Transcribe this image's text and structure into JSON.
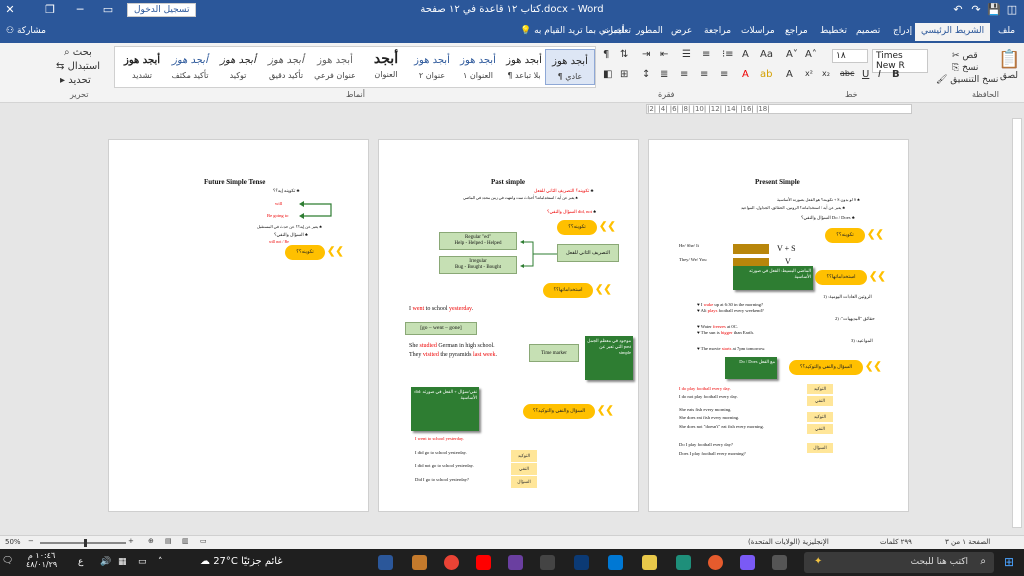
{
  "window": {
    "title": "كتاب ١٢ قاعدة في ١٢ صفحة.docx - Word",
    "signin": "تسجيل الدخول"
  },
  "tabs": [
    "ملف",
    "الشريط الرئيسي",
    "إدراج",
    "تصميم",
    "تخطيط",
    "مراجع",
    "مراسلات",
    "مراجعة",
    "عرض",
    "المطور",
    "تعليمات"
  ],
  "tell_me": "أخبرني بما تريد القيام به",
  "share": "مشاركة",
  "ribbon": {
    "groups": {
      "clipboard": "الحافظة",
      "font": "خط",
      "paragraph": "فقرة",
      "styles": "أنماط",
      "editing": "تحرير"
    },
    "clipboard": {
      "paste": "لصق",
      "cut": "قص",
      "copy": "نسخ",
      "format_painter": "نسخ التنسيق"
    },
    "font": {
      "name": "Times New R",
      "size": "١٨"
    },
    "editing": {
      "find": "بحث",
      "replace": "استبدال",
      "select": "تحديد"
    },
    "styles": [
      {
        "sample": "أبجد هوز",
        "name": "¶ عادي"
      },
      {
        "sample": "أبجد هوز",
        "name": "¶ بلا تباعد"
      },
      {
        "sample": "أبجد هوز",
        "name": "العنوان ١"
      },
      {
        "sample": "أبجد هوز",
        "name": "عنوان ٢"
      },
      {
        "sample": "أبجد",
        "name": "العنوان"
      },
      {
        "sample": "أبجد هوز",
        "name": "عنوان فرعي"
      },
      {
        "sample": "أبجد هوز",
        "name": "تأكيد دقيق"
      },
      {
        "sample": "أبجد هوز",
        "name": "توكيد"
      },
      {
        "sample": "أبجد هوز",
        "name": "تأكيد مكثف"
      },
      {
        "sample": "أبجد هوز",
        "name": "تشديد"
      }
    ]
  },
  "ruler": "|2| |4| |6| |8| |10| |12| |14| |16| |18|",
  "pages": {
    "right": {
      "title": "Present Simple",
      "q1": "تكوينه؟ هو الفعل بصورته الأساسية + S لو بدون S",
      "q2": "يعبر عن أيه / استخداماته؟ الروتين، الحقائق، الجداول، المواعيد",
      "q3": "السؤال والنفي؟ Do / Does",
      "pill1": "تكوينه؟؟",
      "formula1": "He/ She/ It",
      "formula2": "They/ We/ You",
      "vs": "V + S",
      "v": "V",
      "pill2": "استخداماتها؟؟",
      "green1": "الماضي البسيط: الفعل في صورته الأساسية",
      "u1": "الروتين العادات اليومية:",
      "ex1a_pre": "I ",
      "ex1a_red": "wake",
      "ex1a_post": " up at 6:30 in the morning?",
      "ex1b_pre": "Ali ",
      "ex1b_red": "plays",
      "ex1b_post": " football every weekend?",
      "u2": "حقائق \"البديهيات\":",
      "ex2a_pre": "Water ",
      "ex2a_red": "freezes",
      "ex2a_post": " at 0C.",
      "ex2b_pre": "The sun is ",
      "ex2b_red": "bigger",
      "ex2b_post": " than Earth.",
      "u3": "المواعيد:",
      "ex3_pre": "The movie ",
      "ex3_red": "starts",
      "ex3_post": " at 7pm tomorrow.",
      "green2": "Do / Does مع الفعل",
      "pill3": "السؤال والنفي والتوكيد؟؟",
      "s1": "I do play football every day.",
      "s2": "I do not play football every day.",
      "s3": "She eats fish every morning.",
      "s4": "She does eat fish every morning.",
      "s5": "She does not \"doesn't\" eat fish every morning.",
      "s6": "Do I play football every day?",
      "s7": "Does I play football every morning?",
      "lbl1": "التوكيد",
      "lbl2": "النفي",
      "lbl3": "التوكيد",
      "lbl4": "النفي",
      "lbl5": "السؤال"
    },
    "middle": {
      "title": "Past simple",
      "q1": "تكوينه؟ التصريف الثاني للفعل",
      "q2": "يعبر عن أيه / استخداماته؟ أحداث تمت وانتهت في زمن محدد في الماضي",
      "q3": "السؤال والنفي؟ did, not",
      "pill1": "تكوينه؟؟",
      "box1a": "Regular \"ed\"",
      "box1b": "Help - Helped - Helped",
      "box2a": "Irregular",
      "box2b": "Bug - Bought - Bought",
      "green1": "التصريف الثاني للفعل",
      "pill2": "استخداماتها؟؟",
      "ex1_pre": "I ",
      "ex1_red": "went",
      "ex1_mid": " to school ",
      "ex1_red2": "yesterday",
      "ex1_post": ".",
      "forms": "[go – went – gone]",
      "ex2_pre": "She ",
      "ex2_red": "studied",
      "ex2_post": " German in high school.",
      "ex3_pre": "They ",
      "ex3_red": "visited",
      "ex3_mid": " the pyramids ",
      "ex3_red2": "last week",
      "ex3_post": ".",
      "time_marker": "Time marker",
      "green2": "موجود في معظم الجمل التي تعبر عن past simple",
      "green3": "did: نفي/سؤال + الفعل في صورته الأساسية",
      "pill3": "السؤال والنفي والتوكيد؟؟",
      "s1": "I went to school yesterday.",
      "s2": "I did go to school yesterday.",
      "s3": "I did not go to school yesterday.",
      "s4": "Did I go to school yesterday?",
      "lbl1": "التوكيد",
      "lbl2": "النفي",
      "lbl3": "السؤال"
    },
    "left": {
      "title": "Future Simple Tense",
      "q1": "تكوينه إيه؟؟",
      "will": "will",
      "going": "Be going to",
      "q2": "يعبر عن إيه؟؟ عن حدث في المستقبل",
      "q3": "السؤال والنفي؟",
      "q3b": "will not / Be",
      "pill1": "تكوينه؟؟"
    }
  },
  "status": {
    "page": "الصفحة ١ من ٣",
    "words": "٢٩٩ كلمات",
    "lang": "الإنجليزية (الولايات المتحدة)",
    "zoom": "50%"
  },
  "taskbar": {
    "search": "اكتب هنا للبحث",
    "weather": "27°C",
    "weather_desc": "غائم جزئيًا",
    "time": "١٠:٤٦ م",
    "date": "٤٨/٠١/٢٩",
    "lang": "ع"
  },
  "colors": {
    "word_blue": "#2b579a",
    "pill_yellow": "#ffc000",
    "green_light": "#c6e0b4",
    "green_dark": "#2e7d32",
    "red": "#e00000"
  }
}
